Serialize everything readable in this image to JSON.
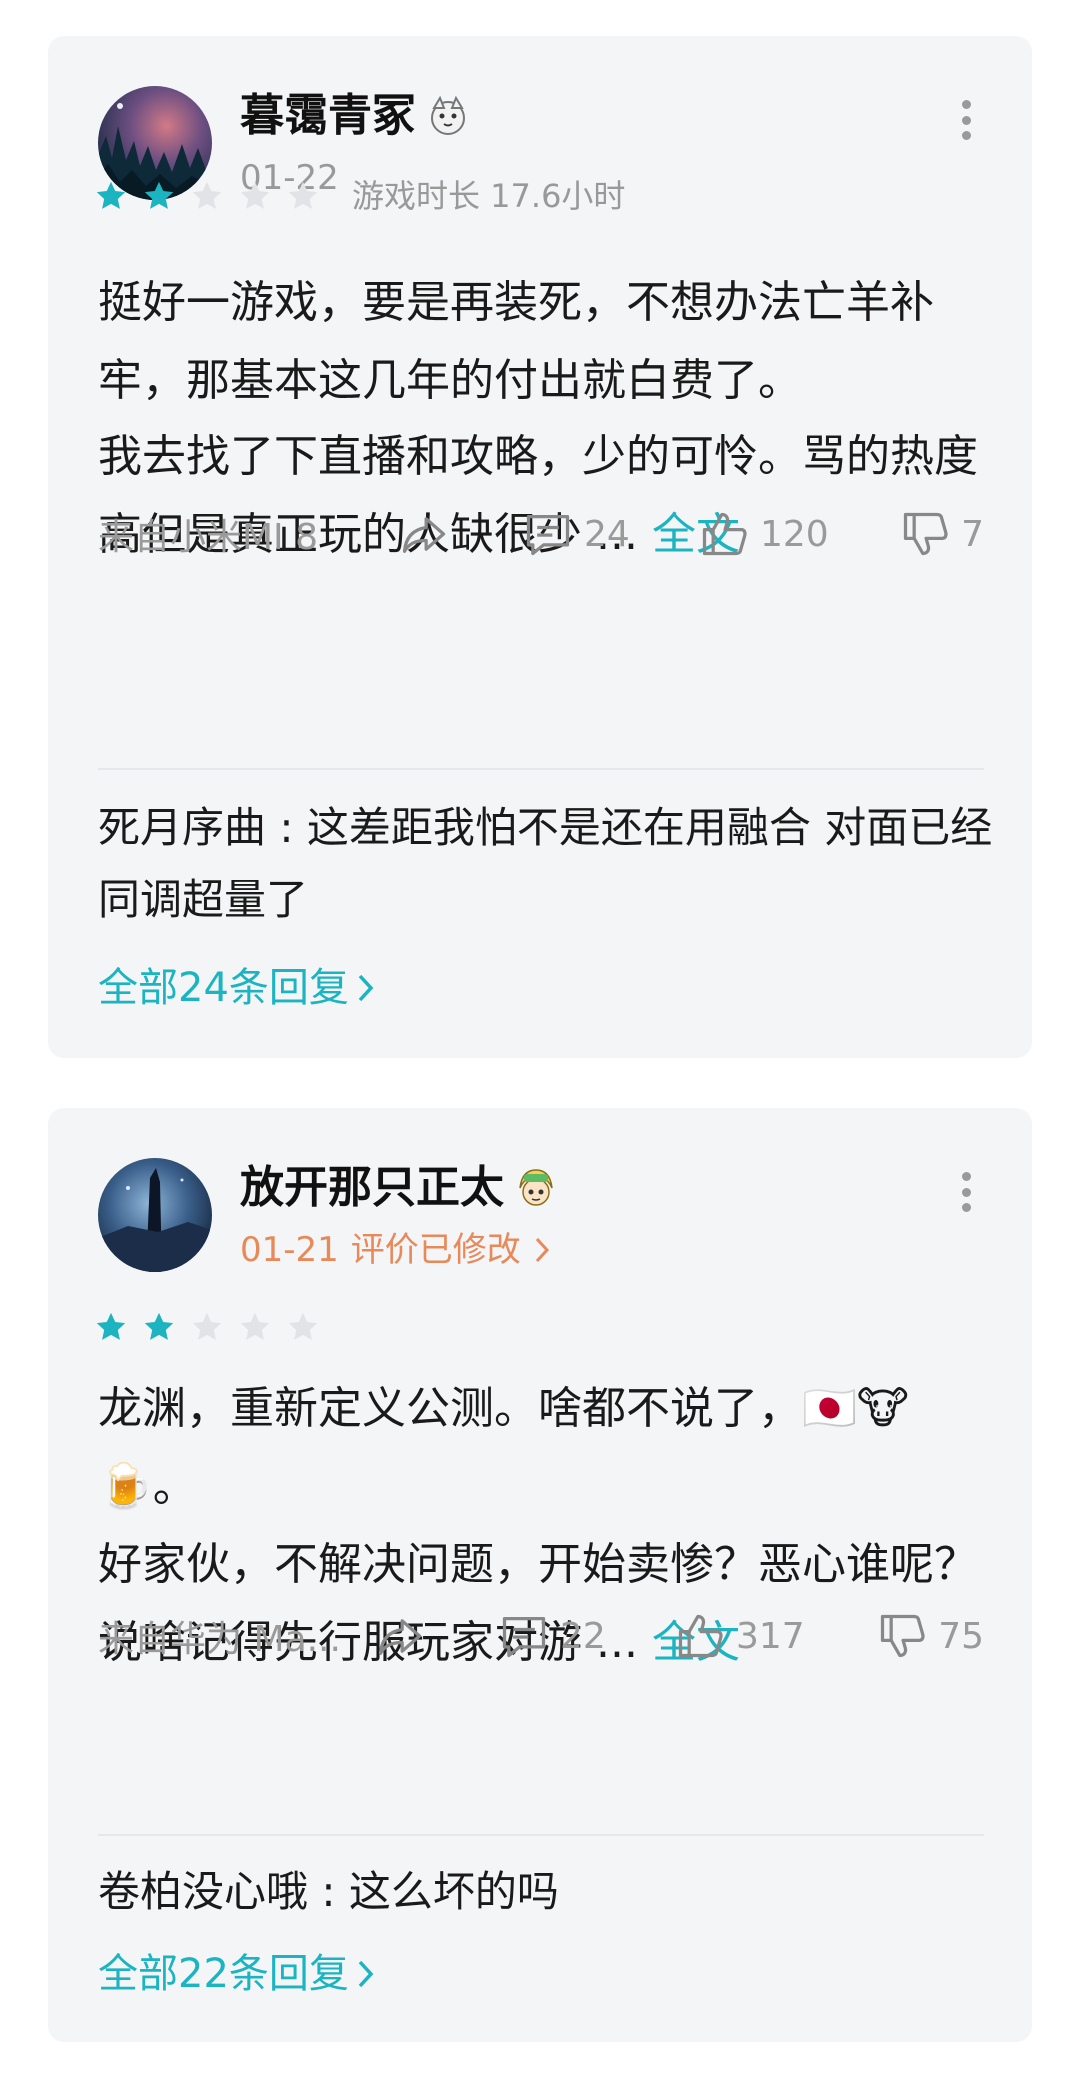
{
  "reviews": [
    {
      "username": "暮霭青冢",
      "date": "01-22",
      "edited_label": "",
      "rating": 2,
      "playtime": "游戏时长 17.6小时",
      "para1": "挺好一游戏，要是再装死，不想办法亡羊补牢，那基本这几年的付出就白费了。",
      "para2": "我去找了下直播和攻略，少的可怜。骂的热度高但是真正玩的人缺很少 ...",
      "full_text": "全文",
      "device": "来自小米MI 8",
      "comments": "24",
      "likes": "120",
      "dislikes": "7",
      "reply_user": "死月序曲",
      "reply_sep": " : ",
      "reply_text": "这差距我怕不是还在用融合 对面已经同调超量了",
      "all_replies": "全部24条回复"
    },
    {
      "username": "放开那只正太",
      "date": "01-21",
      "edited_label": "评价已修改",
      "rating": 2,
      "playtime": "",
      "para1": "龙渊，重新定义公测。啥都不说了，🇯🇵🐮🍺。",
      "para2": "好家伙，不解决问题，开始卖惨？恶心谁呢？说啥记得先行服玩家对游 ...",
      "full_text": "全文",
      "device": "来自华为 Ma...",
      "comments": "22",
      "likes": "317",
      "dislikes": "75",
      "reply_user": "卷柏没心哦",
      "reply_sep": " : ",
      "reply_text": "这么坏的吗",
      "all_replies": "全部22条回复"
    }
  ],
  "icons": {
    "more": "more-vertical-icon",
    "share": "share-icon",
    "comment": "comment-icon",
    "like": "thumbs-up-icon",
    "dislike": "thumbs-down-icon",
    "star": "star-icon",
    "chevron": "chevron-right-icon"
  },
  "colors": {
    "accent": "#1bb4c0",
    "edited": "#e8895a",
    "star_empty": "#e1e3e6",
    "muted": "#999999"
  }
}
